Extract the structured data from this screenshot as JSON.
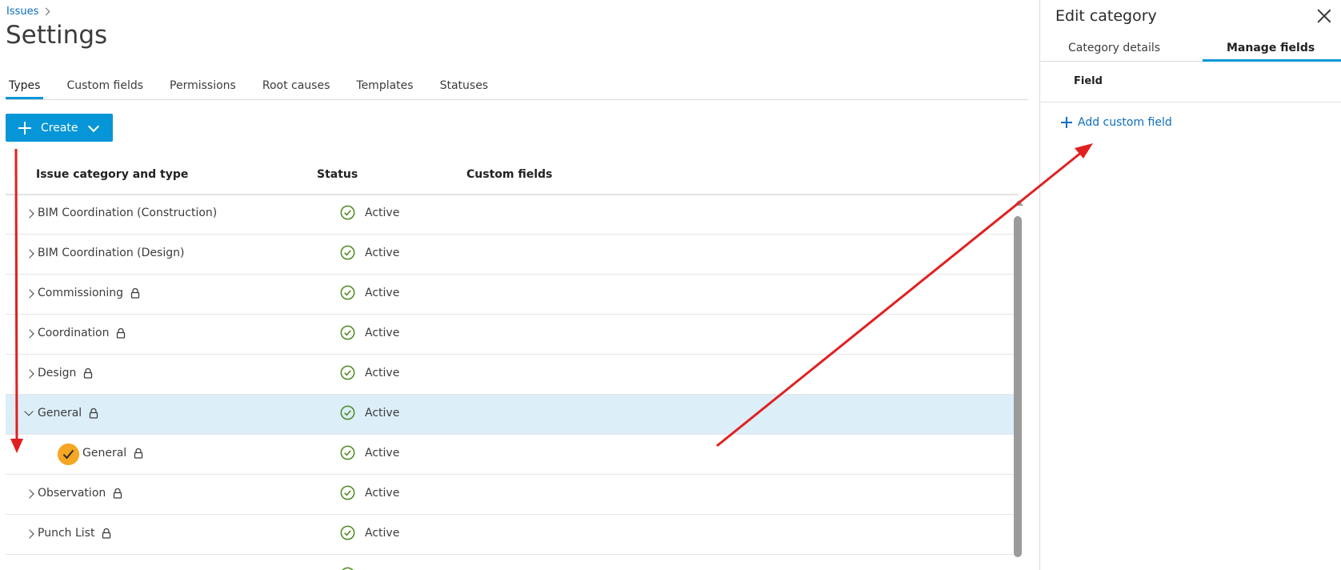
{
  "breadcrumb": {
    "label": "Issues"
  },
  "page": {
    "title": "Settings"
  },
  "tabs": [
    "Types",
    "Custom fields",
    "Permissions",
    "Root causes",
    "Templates",
    "Statuses"
  ],
  "toolbar": {
    "create_label": "Create"
  },
  "table": {
    "headers": {
      "category": "Issue category and type",
      "status": "Status",
      "custom_fields": "Custom fields"
    },
    "rows": [
      {
        "name": "BIM Coordination (Construction)",
        "status": "Active"
      },
      {
        "name": "BIM Coordination (Design)",
        "status": "Active"
      },
      {
        "name": "Commissioning",
        "status": "Active"
      },
      {
        "name": "Coordination",
        "status": "Active"
      },
      {
        "name": "Design",
        "status": "Active"
      },
      {
        "name": "General",
        "status": "Active"
      },
      {
        "name": "General",
        "status": "Active"
      },
      {
        "name": "Observation",
        "status": "Active"
      },
      {
        "name": "Punch List",
        "status": "Active"
      }
    ]
  },
  "panel": {
    "title": "Edit category",
    "tabs": [
      "Category details",
      "Manage fields"
    ],
    "field_header": "Field",
    "add_field_label": "Add custom field"
  },
  "colors": {
    "accent": "#0696d7",
    "active_green": "#4c8a23",
    "selected_row": "#dceef8",
    "type_badge": "#f5a623",
    "annotation_red": "#e02020"
  }
}
